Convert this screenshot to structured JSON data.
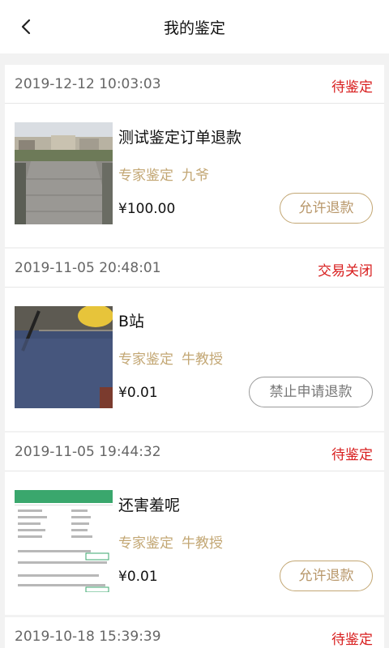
{
  "header": {
    "title": "我的鉴定",
    "back_icon": "chevron-left-icon"
  },
  "orders": [
    {
      "date": "2019-12-12 10:03:03",
      "status": "待鉴定",
      "status_color": "#d81e1e",
      "title": "测试鉴定订单退款",
      "type": "专家鉴定",
      "expert": "九爷",
      "price": "¥100.00",
      "action": "允许退款",
      "action_enabled": true
    },
    {
      "date": "2019-11-05 20:48:01",
      "status": "交易关闭",
      "status_color": "#d81e1e",
      "title": "B站",
      "type": "专家鉴定",
      "expert": "牛教授",
      "price": "¥0.01",
      "action": "禁止申请退款",
      "action_enabled": false
    },
    {
      "date": "2019-11-05 19:44:32",
      "status": "待鉴定",
      "status_color": "#d81e1e",
      "title": "还害羞呢",
      "type": "专家鉴定",
      "expert": "牛教授",
      "price": "¥0.01",
      "action": "允许退款",
      "action_enabled": true
    },
    {
      "date": "2019-10-18 15:39:39",
      "status": "待鉴定",
      "status_color": "#d81e1e"
    }
  ],
  "colors": {
    "accent_gold": "#c3a774",
    "status_red": "#d81e1e",
    "disabled_grey": "#9a9a9a"
  }
}
